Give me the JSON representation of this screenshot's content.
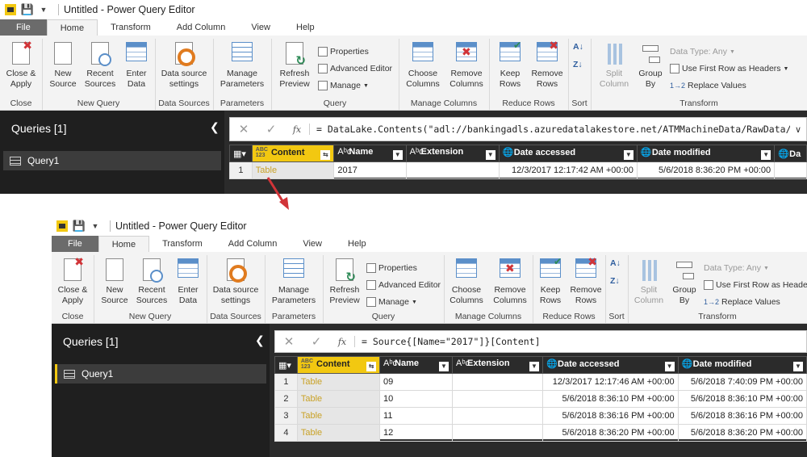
{
  "windows": [
    {
      "title": "Untitled - Power Query Editor",
      "tabs": [
        "File",
        "Home",
        "Transform",
        "Add Column",
        "View",
        "Help"
      ],
      "active_tab": "Home",
      "ribbon": {
        "close_apply": "Close & Apply",
        "new_source": "New Source",
        "recent_sources": "Recent Sources",
        "enter_data": "Enter Data",
        "data_source_settings": "Data source settings",
        "manage_parameters": "Manage Parameters",
        "refresh_preview": "Refresh Preview",
        "properties": "Properties",
        "advanced_editor": "Advanced Editor",
        "manage": "Manage",
        "choose_columns": "Choose Columns",
        "remove_columns": "Remove Columns",
        "keep_rows": "Keep Rows",
        "remove_rows": "Remove Rows",
        "split_column": "Split Column",
        "group_by": "Group By",
        "data_type": "Data Type: Any",
        "use_first_row": "Use First Row as Headers",
        "replace_values": "Replace Values",
        "groups": [
          "Close",
          "New Query",
          "Data Sources",
          "Parameters",
          "Query",
          "Manage Columns",
          "Reduce Rows",
          "Sort",
          "Transform"
        ]
      },
      "queries_header": "Queries [1]",
      "query_item": "Query1",
      "formula": "= DataLake.Contents(\"adl://bankingadls.azuredatalakestore.net/ATMMachineData/RawData/\")",
      "columns": [
        "Content",
        "Name",
        "Extension",
        "Date accessed",
        "Date modified",
        "Da"
      ],
      "rows": [
        {
          "num": "1",
          "content": "Table",
          "name": "2017",
          "ext": "",
          "accessed": "12/3/2017 12:17:42 AM +00:00",
          "modified": "5/6/2018 8:36:20 PM +00:00"
        }
      ]
    },
    {
      "title": "Untitled - Power Query Editor",
      "tabs": [
        "File",
        "Home",
        "Transform",
        "Add Column",
        "View",
        "Help"
      ],
      "active_tab": "Home",
      "ribbon": {
        "close_apply": "Close & Apply",
        "new_source": "New Source",
        "recent_sources": "Recent Sources",
        "enter_data": "Enter Data",
        "data_source_settings": "Data source settings",
        "manage_parameters": "Manage Parameters",
        "refresh_preview": "Refresh Preview",
        "properties": "Properties",
        "advanced_editor": "Advanced Editor",
        "manage": "Manage",
        "choose_columns": "Choose Columns",
        "remove_columns": "Remove Columns",
        "keep_rows": "Keep Rows",
        "remove_rows": "Remove Rows",
        "split_column": "Split Column",
        "group_by": "Group By",
        "data_type": "Data Type: Any",
        "use_first_row": "Use First Row as Headers",
        "replace_values": "Replace Values",
        "groups": [
          "Close",
          "New Query",
          "Data Sources",
          "Parameters",
          "Query",
          "Manage Columns",
          "Reduce Rows",
          "Sort",
          "Transform"
        ]
      },
      "queries_header": "Queries [1]",
      "query_item": "Query1",
      "formula": "= Source{[Name=\"2017\"]}[Content]",
      "columns": [
        "Content",
        "Name",
        "Extension",
        "Date accessed",
        "Date modified"
      ],
      "rows": [
        {
          "num": "1",
          "content": "Table",
          "name": "09",
          "ext": "",
          "accessed": "12/3/2017 12:17:46 AM +00:00",
          "modified": "5/6/2018 7:40:09 PM +00:00"
        },
        {
          "num": "2",
          "content": "Table",
          "name": "10",
          "ext": "",
          "accessed": "5/6/2018 8:36:10 PM +00:00",
          "modified": "5/6/2018 8:36:10 PM +00:00"
        },
        {
          "num": "3",
          "content": "Table",
          "name": "11",
          "ext": "",
          "accessed": "5/6/2018 8:36:16 PM +00:00",
          "modified": "5/6/2018 8:36:16 PM +00:00"
        },
        {
          "num": "4",
          "content": "Table",
          "name": "12",
          "ext": "",
          "accessed": "5/6/2018 8:36:20 PM +00:00",
          "modified": "5/6/2018 8:36:20 PM +00:00"
        }
      ]
    }
  ],
  "colors": {
    "accent": "#f2c811",
    "dark": "#2b2b2b",
    "file_tab": "#6b6b6b",
    "arrow": "#d13438"
  }
}
